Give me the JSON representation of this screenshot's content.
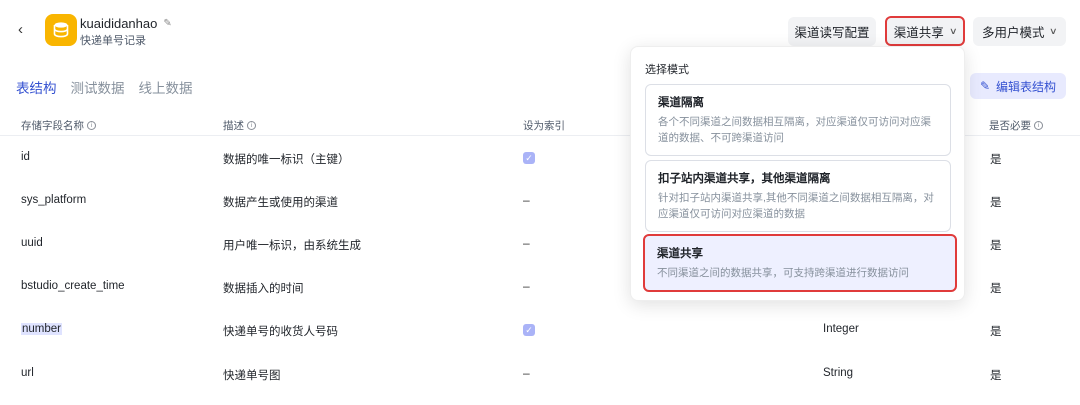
{
  "header": {
    "app_name": "kuaididanhao",
    "app_subtitle": "快递单号记录",
    "buttons": {
      "read_write": "渠道读写配置",
      "share": "渠道共享",
      "multi_user": "多用户模式"
    }
  },
  "tabs": [
    {
      "label": "表结构",
      "active": true
    },
    {
      "label": "测试数据",
      "active": false
    },
    {
      "label": "线上数据",
      "active": false
    }
  ],
  "edit_button": "编辑表结构",
  "table": {
    "headers": {
      "field": "存储字段名称",
      "desc": "描述",
      "index": "设为索引",
      "required": "是否必要"
    },
    "rows": [
      {
        "field": "id",
        "desc": "数据的唯一标识（主键）",
        "index": "checked",
        "type": "",
        "required": "是"
      },
      {
        "field": "sys_platform",
        "desc": "数据产生或使用的渠道",
        "index": "–",
        "type": "",
        "required": "是"
      },
      {
        "field": "uuid",
        "desc": "用户唯一标识，由系统生成",
        "index": "–",
        "type": "",
        "required": "是"
      },
      {
        "field": "bstudio_create_time",
        "desc": "数据插入的时间",
        "index": "–",
        "type": "",
        "required": "是"
      },
      {
        "field": "number",
        "desc": "快递单号的收货人号码",
        "index": "checked",
        "type": "Integer",
        "required": "是"
      },
      {
        "field": "url",
        "desc": "快递单号图",
        "index": "–",
        "type": "String",
        "required": "是"
      }
    ]
  },
  "dropdown": {
    "title": "选择模式",
    "options": [
      {
        "title": "渠道隔离",
        "desc": "各个不同渠道之间数据相互隔离，对应渠道仅可访问对应渠道的数据、不可跨渠道访问"
      },
      {
        "title": "扣子站内渠道共享，其他渠道隔离",
        "desc": "针对扣子站内渠道共享,其他不同渠道之间数据相互隔离，对应渠道仅可访问对应渠道的数据"
      },
      {
        "title": "渠道共享",
        "desc": "不同渠道之间的数据共享，可支持跨渠道进行数据访问",
        "selected": true
      }
    ]
  },
  "colors": {
    "accent": "#3451d1",
    "highlight_border": "#e03b3b",
    "app_icon": "#f9b500"
  }
}
